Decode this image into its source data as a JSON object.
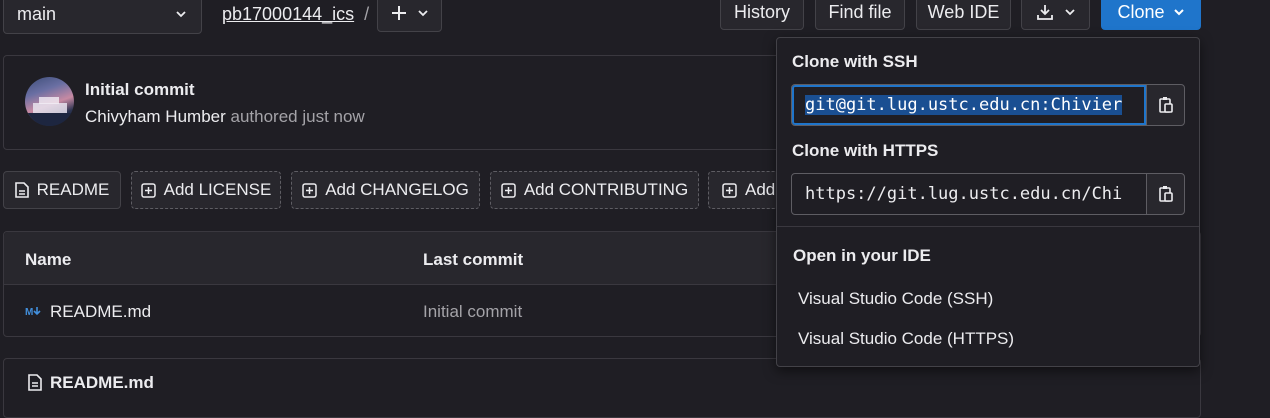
{
  "topbar": {
    "branch": "main",
    "repo": "pb17000144_ics",
    "separator": "/",
    "history": "History",
    "find_file": "Find file",
    "web_ide": "Web IDE",
    "clone": "Clone"
  },
  "commit": {
    "title": "Initial commit",
    "author": "Chivyham Humber",
    "meta": "authored just now"
  },
  "quick_actions": {
    "readme": "README",
    "add_license": "Add LICENSE",
    "add_changelog": "Add CHANGELOG",
    "add_contributing": "Add CONTRIBUTING",
    "add_partial": "Add"
  },
  "file_table": {
    "headers": {
      "name": "Name",
      "last_commit": "Last commit"
    },
    "rows": [
      {
        "name": "README.md",
        "icon": "markdown-icon",
        "last_commit": "Initial commit"
      }
    ]
  },
  "readme_panel": {
    "title": "README.md"
  },
  "clone_dropdown": {
    "ssh_label": "Clone with SSH",
    "ssh_url": "git@git.lug.ustc.edu.cn:Chivier",
    "https_label": "Clone with HTTPS",
    "https_url": "https://git.lug.ustc.edu.cn/Chi",
    "ide_label": "Open in your IDE",
    "ide_ssh": "Visual Studio Code (SSH)",
    "ide_https": "Visual Studio Code (HTTPS)"
  },
  "colors": {
    "background": "#1f1e24",
    "accent_blue": "#1f75cb",
    "selection": "#1a4f92",
    "text": "#ececef",
    "muted": "#a4a3a8"
  }
}
